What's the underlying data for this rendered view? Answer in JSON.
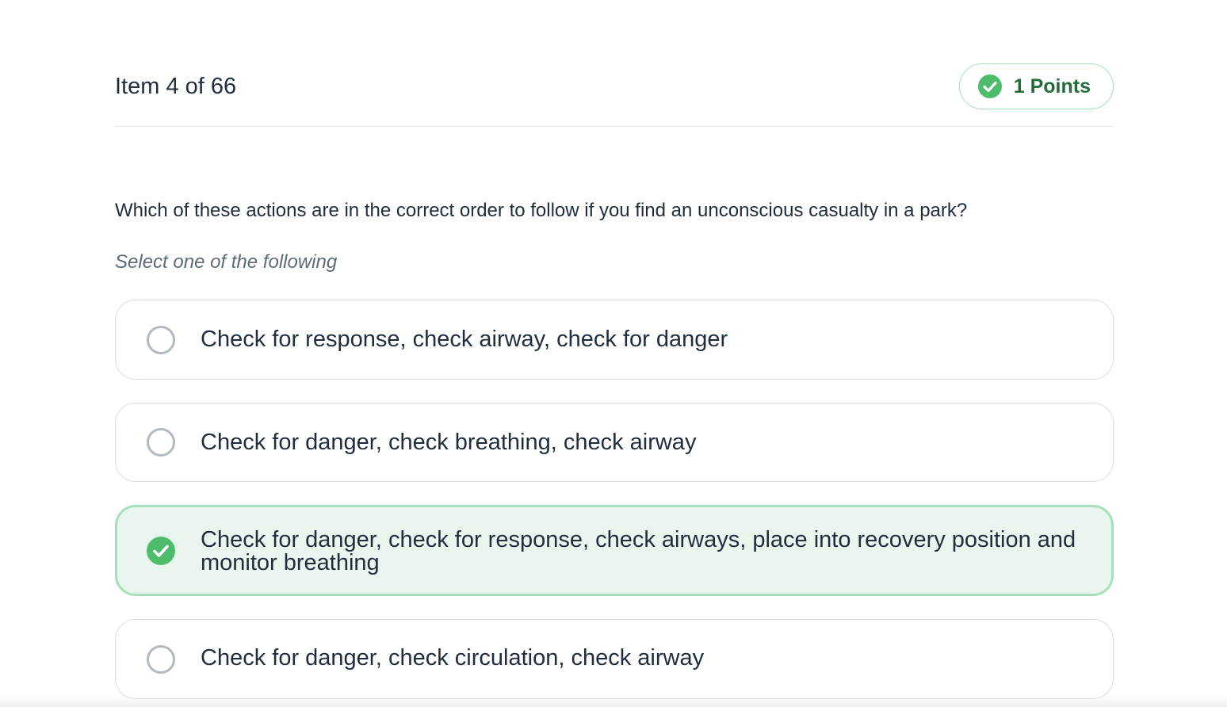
{
  "header": {
    "item_counter": "Item 4 of 66",
    "points_label": "1 Points",
    "points_icon": "check-circle-icon"
  },
  "question": {
    "text": "Which of these actions are in the correct order to follow if you find an unconscious casualty in a park?",
    "instruction": "Select one of the following"
  },
  "options": [
    {
      "label": "Check for response, check airway, check for danger",
      "selected": false
    },
    {
      "label": "Check for danger, check breathing, check airway",
      "selected": false
    },
    {
      "label": "Check for danger, check for response, check airways, place into recovery position and monitor breathing",
      "selected": true
    },
    {
      "label": "Check for danger, check circulation, check airway",
      "selected": false
    }
  ],
  "colors": {
    "accent_green": "#4dbd6b",
    "selected_bg": "#e9f6ee",
    "selected_border": "#a6dfbb",
    "text": "#1f2d3d"
  }
}
